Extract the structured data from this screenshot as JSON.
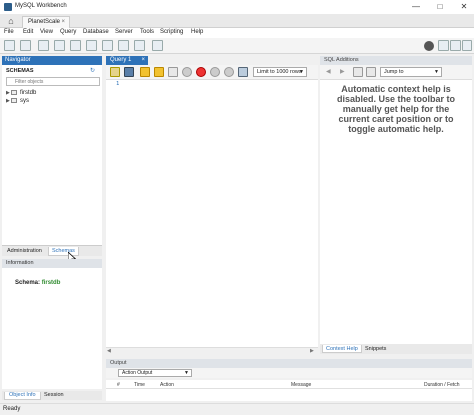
{
  "window": {
    "title": "MySQL Workbench"
  },
  "tabs": {
    "connection_tab": "PlanetScale",
    "close": "×"
  },
  "menu": [
    "File",
    "Edit",
    "View",
    "Query",
    "Database",
    "Server",
    "Tools",
    "Scripting",
    "Help"
  ],
  "navigator": {
    "header": "Navigator",
    "schemas_label": "SCHEMAS",
    "filter_placeholder": "Filter objects",
    "schemas": [
      "firstdb",
      "sys"
    ],
    "tabs": [
      "Administration",
      "Schemas"
    ],
    "active_tab": "Schemas"
  },
  "information": {
    "header": "Information",
    "schema_label": "Schema:",
    "schema_value": "firstdb",
    "tabs": [
      "Object Info",
      "Session"
    ],
    "active_tab": "Object Info"
  },
  "editor": {
    "tab_label": "Query 1",
    "limit_label": "Limit to 1000 rows",
    "line_numbers": [
      "1"
    ]
  },
  "sql_additions": {
    "header": "SQL Additions",
    "jump_label": "Jump to",
    "help_text": "Automatic context help is disabled. Use the toolbar to manually get help for the current caret position or to toggle automatic help.",
    "tabs": [
      "Context Help",
      "Snippets"
    ],
    "active_tab": "Context Help"
  },
  "output": {
    "header": "Output",
    "mode": "Action Output",
    "columns": [
      "#",
      "Time",
      "Action",
      "Message",
      "Duration / Fetch"
    ]
  },
  "status": {
    "text": "Ready"
  },
  "colors": {
    "accent": "#2e72b8",
    "schema_value": "#2e8b2e",
    "help_text": "#555555"
  }
}
